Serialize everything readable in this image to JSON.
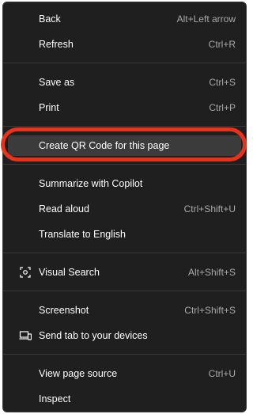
{
  "menu": {
    "back": {
      "label": "Back",
      "shortcut": "Alt+Left arrow"
    },
    "refresh": {
      "label": "Refresh",
      "shortcut": "Ctrl+R"
    },
    "save_as": {
      "label": "Save as",
      "shortcut": "Ctrl+S"
    },
    "print": {
      "label": "Print",
      "shortcut": "Ctrl+P"
    },
    "create_qr": {
      "label": "Create QR Code for this page",
      "shortcut": ""
    },
    "summarize": {
      "label": "Summarize with Copilot",
      "shortcut": ""
    },
    "read_aloud": {
      "label": "Read aloud",
      "shortcut": "Ctrl+Shift+U"
    },
    "translate": {
      "label": "Translate to English",
      "shortcut": ""
    },
    "visual_search": {
      "label": "Visual Search",
      "shortcut": "Alt+Shift+S",
      "icon": "visual-search-icon"
    },
    "screenshot": {
      "label": "Screenshot",
      "shortcut": "Ctrl+Shift+S"
    },
    "send_tab": {
      "label": "Send tab to your devices",
      "shortcut": "",
      "icon": "device-send-icon"
    },
    "view_source": {
      "label": "View page source",
      "shortcut": "Ctrl+U"
    },
    "inspect": {
      "label": "Inspect",
      "shortcut": ""
    }
  },
  "colors": {
    "menu_background": "#1f1f1f",
    "highlight_ring": "#e8321a",
    "hover_background": "#3b3b3b",
    "shortcut_text": "#a9a9a9"
  }
}
